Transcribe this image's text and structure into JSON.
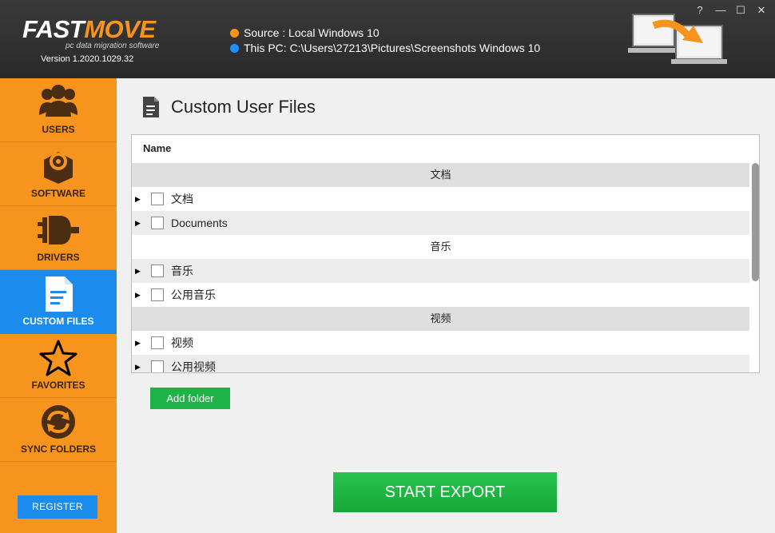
{
  "app": {
    "logo_fast": "FAST",
    "logo_move": "MOVE",
    "tagline": "pc data migration software",
    "version": "Version 1.2020.1029.32"
  },
  "header": {
    "source_label": "Source : Local Windows 10",
    "target_label": "This PC: C:\\Users\\27213\\Pictures\\Screenshots Windows 10"
  },
  "window_controls": {
    "help": "?",
    "minimize": "—",
    "maximize": "☐",
    "close": "✕"
  },
  "sidebar": {
    "items": [
      {
        "label": "USERS",
        "icon": "users-icon"
      },
      {
        "label": "SOFTWARE",
        "icon": "software-icon"
      },
      {
        "label": "DRIVERS",
        "icon": "plug-icon"
      },
      {
        "label": "CUSTOM FILES",
        "icon": "file-icon",
        "active": true
      },
      {
        "label": "FAVORITES",
        "icon": "star-icon"
      },
      {
        "label": "SYNC FOLDERS",
        "icon": "sync-icon"
      }
    ],
    "register_label": "REGISTER"
  },
  "main": {
    "title": "Custom User Files",
    "column_header": "Name",
    "rows": [
      {
        "type": "group",
        "text": "文档"
      },
      {
        "type": "item",
        "text": "文档"
      },
      {
        "type": "item",
        "text": "Documents"
      },
      {
        "type": "group",
        "text": "音乐"
      },
      {
        "type": "item",
        "text": "音乐"
      },
      {
        "type": "item",
        "text": "公用音乐"
      },
      {
        "type": "group",
        "text": "视频"
      },
      {
        "type": "item",
        "text": "视频"
      },
      {
        "type": "item",
        "text": "公用视频"
      }
    ],
    "add_folder_label": "Add folder",
    "start_export_label": "START EXPORT"
  },
  "colors": {
    "sidebar": "#f7941d",
    "active": "#1b8bed",
    "green": "#1db347",
    "header": "#2e2e2e"
  }
}
